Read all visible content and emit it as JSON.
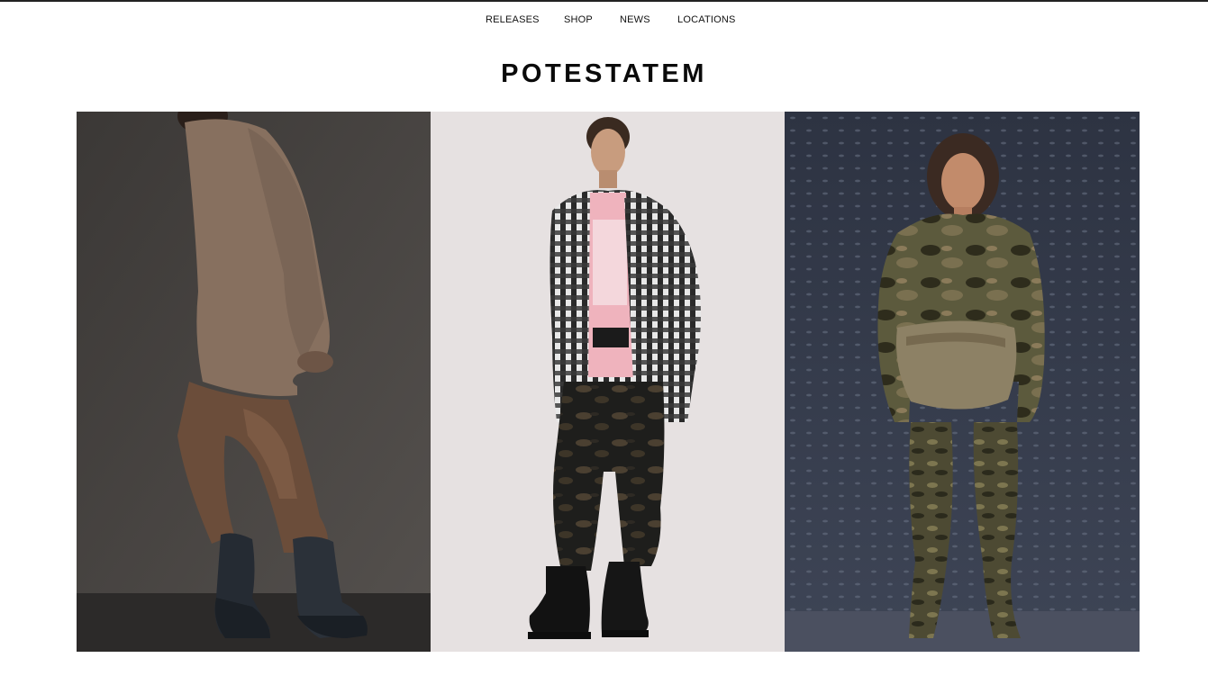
{
  "nav": {
    "items": [
      {
        "label": "RELEASES"
      },
      {
        "label": "SHOP"
      },
      {
        "label": "NEWS"
      },
      {
        "label": "LOCATIONS"
      }
    ]
  },
  "brand": {
    "title": "POTESTATEM"
  },
  "gallery": {
    "images": [
      {
        "label": "model in taupe oversized sweatshirt, brown pants and dark boots"
      },
      {
        "label": "model in plaid shirt jacket, pink tee and camo pants"
      },
      {
        "label": "model in camo jacket with suede waist bag and camo boots"
      }
    ]
  },
  "colors": {
    "text": "#111111",
    "background": "#ffffff",
    "panel1_bg": "#474442",
    "panel2_bg": "#e6e1e1",
    "panel3_bg": "#2f3644"
  }
}
